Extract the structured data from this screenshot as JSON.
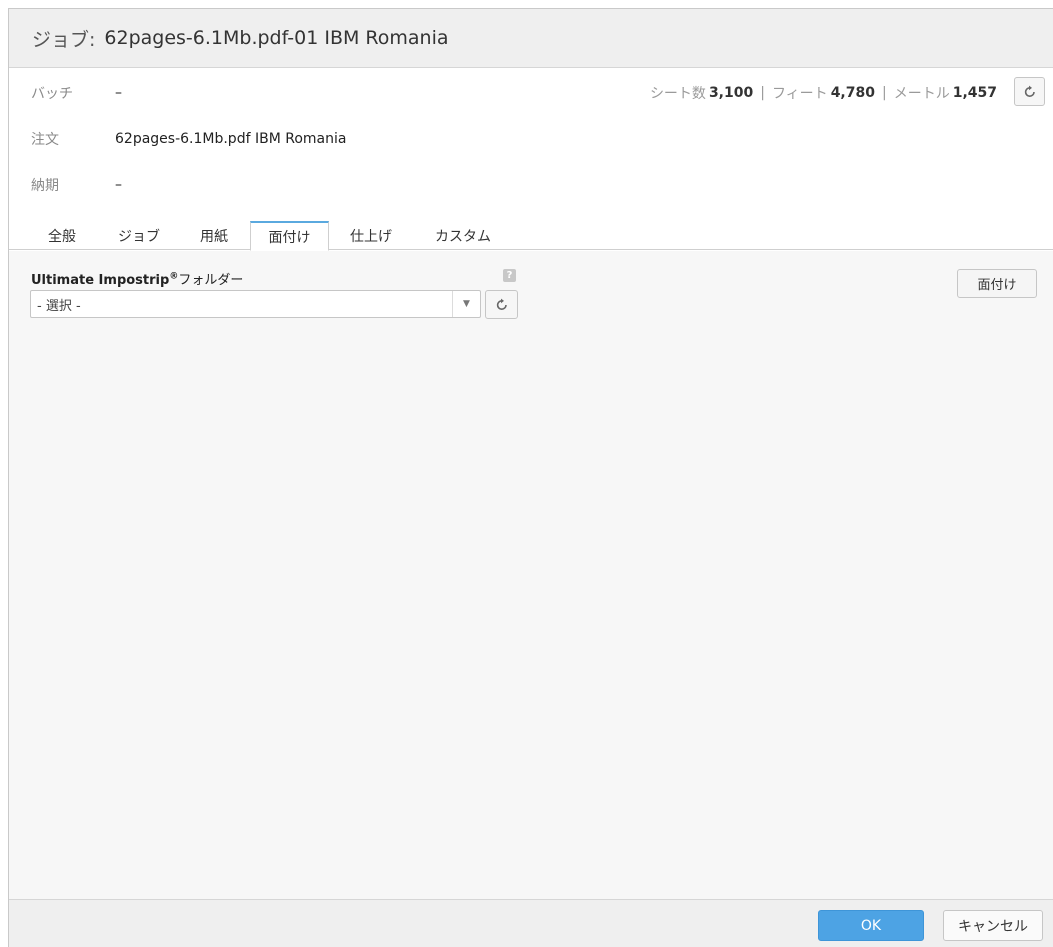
{
  "dialog": {
    "title_prefix": "ジョブ:",
    "title": "62pages-6.1Mb.pdf-01 IBM Romania"
  },
  "info": {
    "batch_label": "バッチ",
    "batch_value": "–",
    "order_label": "注文",
    "order_value": "62pages-6.1Mb.pdf IBM Romania",
    "due_label": "納期",
    "due_value": "–"
  },
  "stats": {
    "sheets_label": "シート数",
    "sheets_value": "3,100",
    "feet_label": "フィート",
    "feet_value": "4,780",
    "meters_label": "メートル",
    "meters_value": "1,457",
    "separator": "|"
  },
  "icons": {
    "refresh": "refresh-icon",
    "dropdown": "chevron-down-icon",
    "help": "help-icon"
  },
  "tabs": [
    {
      "label": "全般",
      "active": false
    },
    {
      "label": "ジョブ",
      "active": false
    },
    {
      "label": "用紙",
      "active": false
    },
    {
      "label": "面付け",
      "active": true
    },
    {
      "label": "仕上げ",
      "active": false
    },
    {
      "label": "カスタム",
      "active": false
    }
  ],
  "imposition": {
    "folder_label_brand": "Ultimate Impostrip",
    "folder_label_reg": "®",
    "folder_label_suffix": "フォルダー",
    "help_glyph": "?",
    "select_value": "- 選択 -",
    "impose_button": "面付け"
  },
  "footer": {
    "ok_label": "OK",
    "cancel_label": "キャンセル"
  },
  "colors": {
    "accent": "#4da3e4",
    "active_tab_border": "#5aa9df"
  }
}
